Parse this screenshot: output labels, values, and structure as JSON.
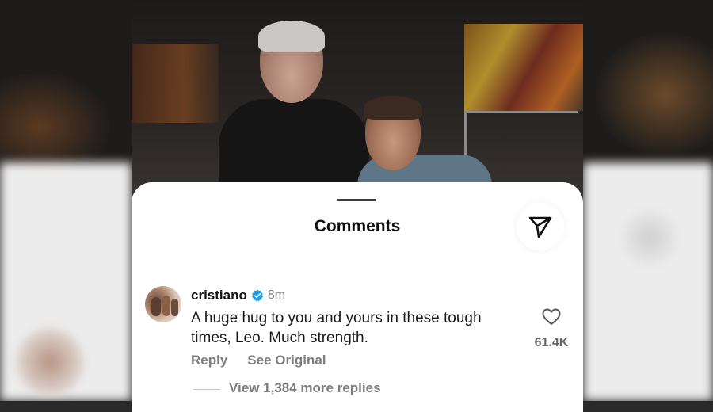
{
  "sheet": {
    "title": "Comments"
  },
  "comment": {
    "username": "cristiano",
    "verified": true,
    "time": "8m",
    "text": "A huge hug to you and yours in these tough times, Leo. Much strength.",
    "reply_label": "Reply",
    "see_original_label": "See Original",
    "like_count": "61.4K",
    "view_replies_label": "View 1,384 more replies"
  },
  "icons": {
    "send": "send-icon",
    "verified": "verified-badge-icon",
    "like": "heart-icon"
  },
  "colors": {
    "verified_blue": "#1d9bf0",
    "secondary_text": "#7d7d7d"
  }
}
